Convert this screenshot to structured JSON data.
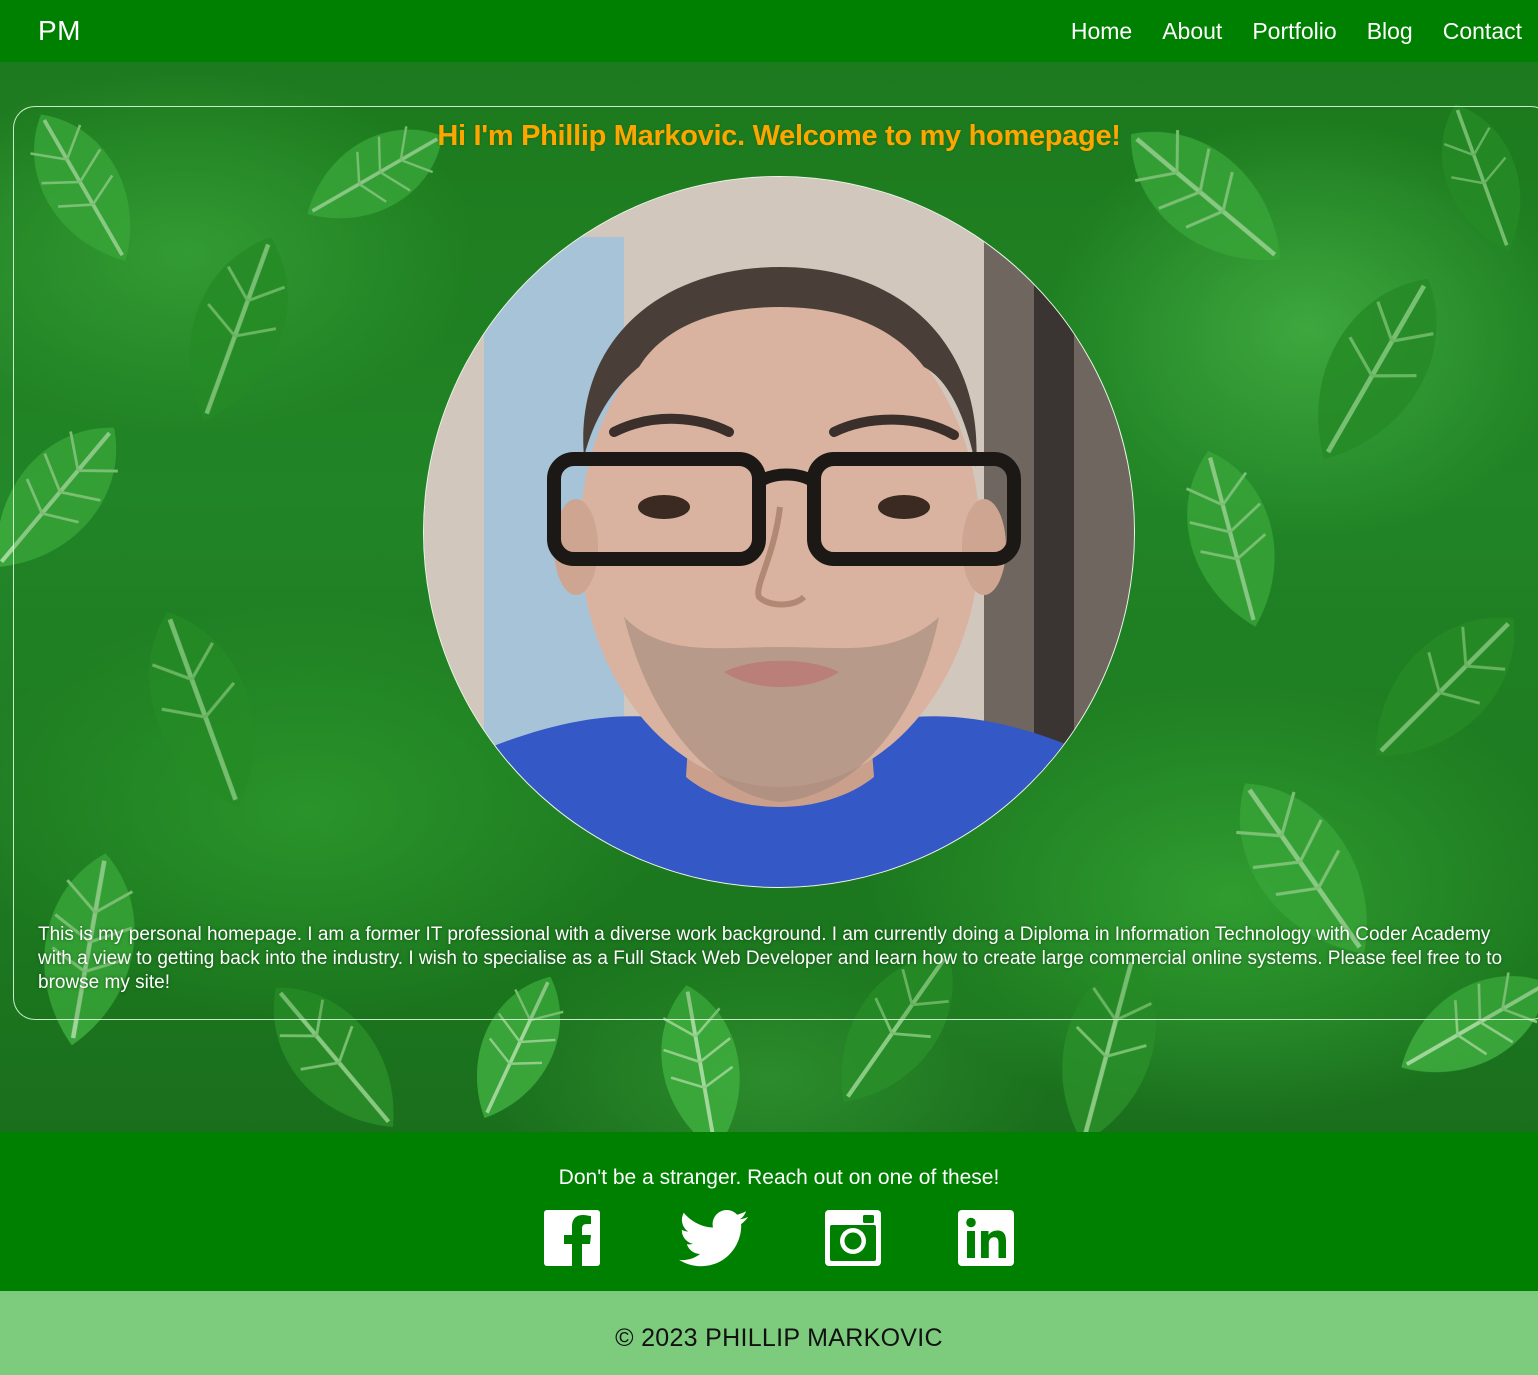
{
  "nav": {
    "brand": "PM",
    "links": [
      "Home",
      "About",
      "Portfolio",
      "Blog",
      "Contact"
    ]
  },
  "hero": {
    "headline": "Hi I'm Phillip Markovic. Welcome to my homepage!",
    "bio": "This is my personal homepage. I am a former IT professional with a diverse work background. I am currently doing a Diploma in Information Technology with Coder Academy with a view to getting back into the industry. I wish to specialise as a Full Stack Web Developer and learn how to create large commercial online systems. Please feel free to to browse my site!"
  },
  "social": {
    "prompt": "Don't be a stranger. Reach out on one of these!",
    "icons": [
      "facebook-icon",
      "twitter-icon",
      "instagram-icon",
      "linkedin-icon"
    ]
  },
  "footer": {
    "copyright": "© 2023 PHILLIP MARKOVIC"
  },
  "colors": {
    "nav_bg": "#008000",
    "headline": "#ffa500",
    "copyright_bg": "#7dcb7d"
  }
}
